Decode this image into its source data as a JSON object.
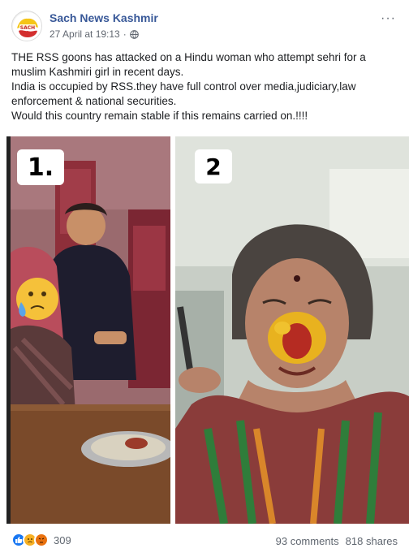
{
  "header": {
    "page_name": "Sach News Kashmir",
    "timestamp": "27 April at 19:13",
    "separator": "·",
    "more_label": "···",
    "avatar_icon": "sach-news-logo-icon",
    "privacy_icon": "globe-icon"
  },
  "caption": {
    "line1": "THE RSS goons has attacked on a Hindu woman who attempt sehri for a muslim Kashmiri girl in recent days.",
    "line2": "India is occupied by RSS.they have full control over media,judiciary,law enforcement & national securities.",
    "line3": "Would this country remain stable if this remains carried on.!!!!"
  },
  "photos": {
    "left_label": "1.",
    "right_label": "2"
  },
  "footer": {
    "reaction_icons": [
      "like-icon",
      "sad-icon",
      "angry-icon"
    ],
    "reaction_count": "309",
    "comments": "93 comments",
    "shares": "818 shares"
  },
  "colors": {
    "link": "#385898",
    "meta": "#616770",
    "like": "#1877f2",
    "sad": "#f7b125",
    "angry": "#e9710f"
  }
}
